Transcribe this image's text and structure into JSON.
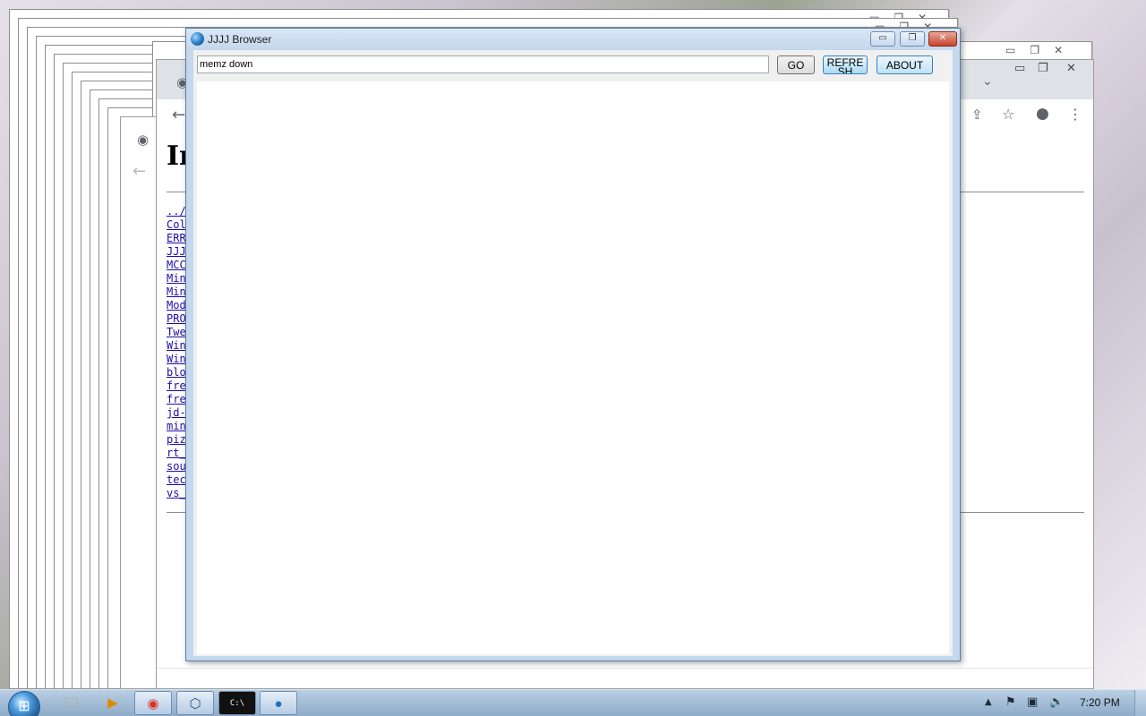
{
  "app": {
    "title": "JJJJ Browser",
    "icon": "globe-icon"
  },
  "toolbar": {
    "url_value": "memz down",
    "go_label": "GO",
    "refresh_label": "REFRESH",
    "about_label": "ABOUT"
  },
  "titlebar_buttons": {
    "minimize": "▭",
    "maximize": "❐",
    "close": "✕"
  },
  "background_chrome": {
    "title_partial": "In",
    "file_links": [
      "../",
      "Col",
      "ERR",
      "JJJ",
      "MCC",
      "Min",
      "Min",
      "Mod",
      "PRO",
      "Twe",
      "Win",
      "Win",
      "blo",
      "fre",
      "fre",
      "jd-",
      "min",
      "piz",
      "rt_",
      "sou",
      "tec",
      "vs_"
    ]
  },
  "taskbar": {
    "clock": "7:20 PM",
    "items": [
      {
        "icon": "explorer-icon",
        "glyph": "🗀"
      },
      {
        "icon": "media-player-icon",
        "glyph": "▶"
      },
      {
        "icon": "chrome-icon",
        "glyph": "◉"
      },
      {
        "icon": "cube-app-icon",
        "glyph": "⬡"
      },
      {
        "icon": "cmd-icon",
        "glyph": "C:\\"
      },
      {
        "icon": "jjjj-browser-icon",
        "glyph": "●"
      }
    ]
  },
  "colors": {
    "window_frame": "#c4d7ec",
    "close_button": "#c7422b",
    "link": "#1a0dab",
    "taskbar": "#9db8d3"
  }
}
